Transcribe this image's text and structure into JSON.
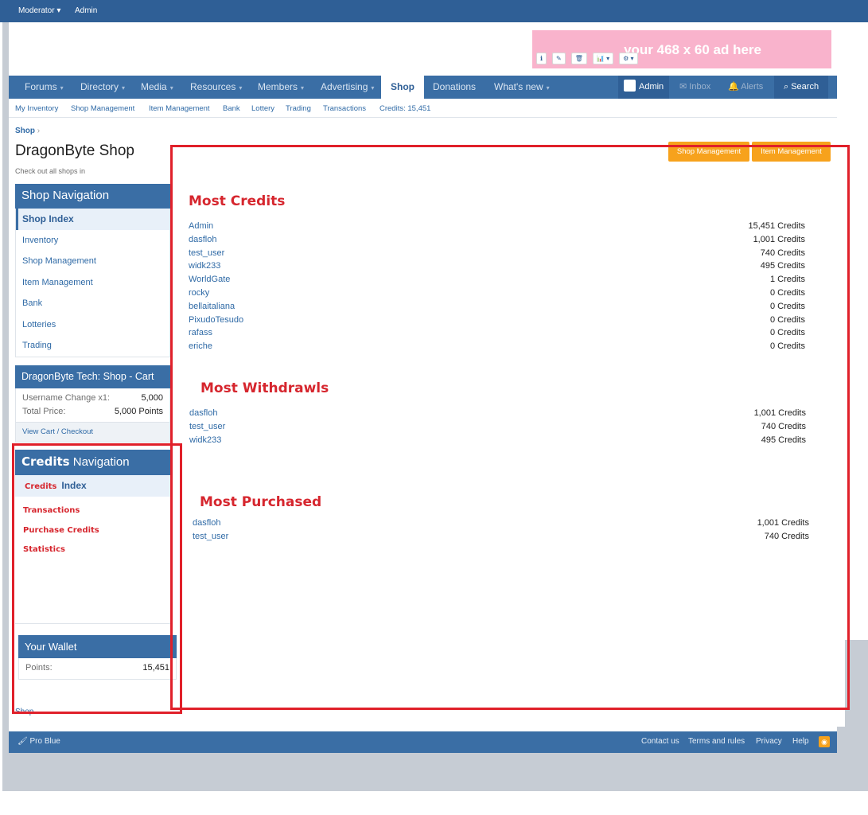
{
  "topbar": {
    "moderator": "Moderator ▾",
    "admin": "Admin"
  },
  "ad": {
    "text": "your 468 x 60 ad here",
    "tools": [
      "ℹ",
      "✎",
      "🗑",
      "📊 ▾",
      "⚙ ▾"
    ]
  },
  "nav": {
    "tabs": [
      {
        "label": "Forums",
        "caret": "▾"
      },
      {
        "label": "Directory",
        "caret": "▾"
      },
      {
        "label": "Media",
        "caret": "▾"
      },
      {
        "label": "Resources",
        "caret": "▾"
      },
      {
        "label": "Members",
        "caret": "▾"
      },
      {
        "label": "Advertising",
        "caret": "▾"
      },
      {
        "label": "Shop",
        "caret": ""
      },
      {
        "label": "Donations",
        "caret": ""
      },
      {
        "label": "What's new",
        "caret": "▾"
      }
    ],
    "admin": "Admin",
    "inbox": "Inbox",
    "alerts": "Alerts",
    "search": "Search"
  },
  "subnav": [
    "My Inventory",
    "Shop Management",
    "Item Management",
    "Bank",
    "Lottery",
    "Trading",
    "Transactions",
    "Credits: 15,451"
  ],
  "breadcrumb": "Shop",
  "breadcrumb_sep": "›",
  "page_title": "DragonByte Shop",
  "page_subtitle": "Check out all shops in",
  "buttons": {
    "shop_management": "Shop Management",
    "item_management": "Item Management"
  },
  "shop_nav": {
    "title": "Shop Navigation",
    "items": [
      "Shop Index",
      "Inventory",
      "Shop Management",
      "Item Management",
      "Bank",
      "Lotteries",
      "Trading"
    ]
  },
  "cart": {
    "title": "DragonByte Tech: Shop - Cart",
    "rows": [
      {
        "label": "Username Change x1:",
        "value": "5,000"
      },
      {
        "label": "Total Price:",
        "value": "5,000 Points"
      }
    ],
    "link": "View Cart / Checkout"
  },
  "credits_nav": {
    "title_bold": "Credits",
    "title_rest": " Navigation",
    "sub_red": "Credits",
    "sub_blue": "Index",
    "links": [
      "Transactions",
      "Purchase Credits",
      "Statistics"
    ]
  },
  "wallet": {
    "title": "Your Wallet",
    "label": "Points:",
    "value": "15,451"
  },
  "sections": {
    "most_credits": {
      "title": "Most Credits",
      "rows": [
        {
          "name": "Admin",
          "value": "15,451 Credits"
        },
        {
          "name": "dasfloh",
          "value": "1,001 Credits"
        },
        {
          "name": "test_user",
          "value": "740 Credits"
        },
        {
          "name": "widk233",
          "value": "495 Credits"
        },
        {
          "name": "WorldGate",
          "value": "1 Credits"
        },
        {
          "name": "rocky",
          "value": "0 Credits"
        },
        {
          "name": "bellaitaliana",
          "value": "0 Credits"
        },
        {
          "name": "PixudoTesudo",
          "value": "0 Credits"
        },
        {
          "name": "rafass",
          "value": "0 Credits"
        },
        {
          "name": "eriche",
          "value": "0 Credits"
        }
      ]
    },
    "most_withdrawls": {
      "title": "Most Withdrawls",
      "rows": [
        {
          "name": "dasfloh",
          "value": "1,001 Credits"
        },
        {
          "name": "test_user",
          "value": "740 Credits"
        },
        {
          "name": "widk233",
          "value": "495 Credits"
        }
      ]
    },
    "most_purchased": {
      "title": "Most Purchased",
      "rows": [
        {
          "name": "dasfloh",
          "value": "1,001 Credits"
        },
        {
          "name": "test_user",
          "value": "740 Credits"
        }
      ]
    }
  },
  "footer": {
    "style": "Pro Blue",
    "links": [
      "Contact us",
      "Terms and rules",
      "Privacy",
      "Help"
    ],
    "crumb": "Shop"
  },
  "colors": {
    "nav_blue": "#3a6ea5",
    "accent_orange": "#f7a21c",
    "annotation_red": "#e0202a",
    "ad_pink": "#f9b3cc"
  }
}
